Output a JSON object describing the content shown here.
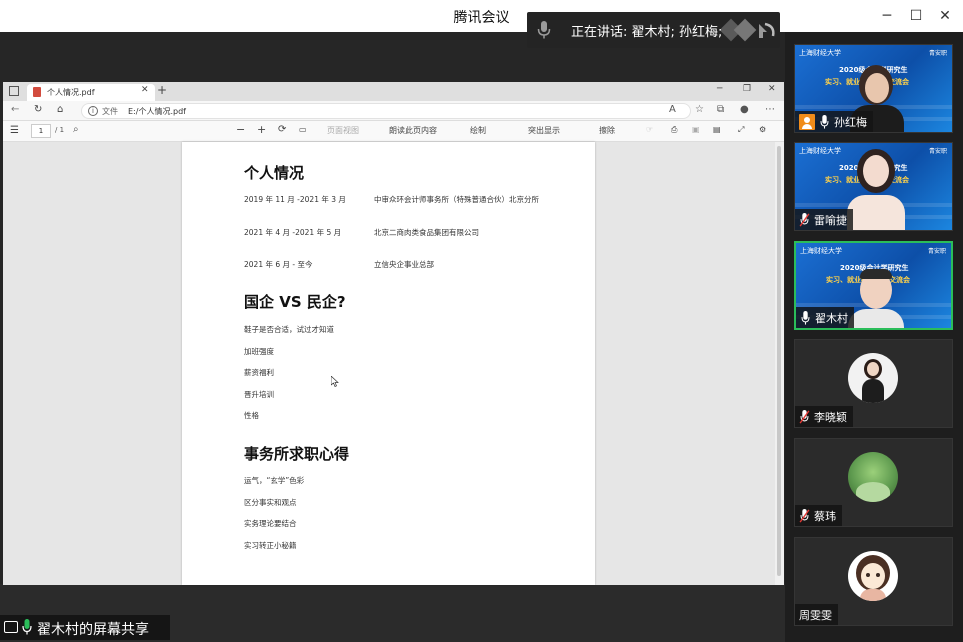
{
  "window": {
    "app_title": "腾讯会议",
    "speaking_label": "正在讲话: 翟木村; 孙红梅;"
  },
  "browser": {
    "tab_title": "个人情况.pdf",
    "url_label": "文件",
    "url": "E:/个人情况.pdf",
    "page_number": "1",
    "page_total": "/ 1",
    "toolbar": {
      "page_view": "页面视图",
      "read_aloud": "朗读此页内容",
      "draw": "绘制",
      "highlight": "突出显示",
      "erase": "擦除"
    }
  },
  "document": {
    "section1_title": "个人情况",
    "experience": [
      {
        "period": "2019 年 11 月 -2021 年 3 月",
        "org": "中审众环会计师事务所（特殊普通合伙）北京分所"
      },
      {
        "period": "2021 年 4 月 -2021 年 5 月",
        "org": "北京二商肉类食品集团有限公司"
      },
      {
        "period": "2021 年 6 月 - 至今",
        "org": "立信央企事业总部"
      }
    ],
    "section2_title": "国企 VS 民企?",
    "section2_items": [
      "鞋子是否合适，试过才知道",
      "加班强度",
      "薪资福利",
      "晋升培训",
      "性格"
    ],
    "section3_title": "事务所求职心得",
    "section3_items": [
      "运气，“玄学”色彩",
      "区分事实和观点",
      "实务理论要结合",
      "实习转正小秘籍"
    ]
  },
  "share": {
    "label": "翟木村的屏幕共享"
  },
  "banner": {
    "logo_left": "上海财经大学",
    "logo_right": "青安职",
    "line1": "2020级会计学研究生",
    "line2": "实习、就业经验分享交流会"
  },
  "participants": [
    {
      "name": "孙红梅",
      "kind": "video-banner",
      "avatar_color": "#f08c1a"
    },
    {
      "name": "雷喻捷",
      "kind": "video-banner",
      "avatar_color": "#f5e5dc"
    },
    {
      "name": "翟木村",
      "kind": "video-banner-active",
      "avatar_color": "#e9e9e9"
    },
    {
      "name": "李晓颖",
      "kind": "avatar",
      "avatar_color": "#f2f2f2"
    },
    {
      "name": "蔡玮",
      "kind": "avatar",
      "avatar_color": "#5e9a4f"
    },
    {
      "name": "周雯雯",
      "kind": "avatar",
      "avatar_color": "#fbe9d6"
    }
  ],
  "colors": {
    "active_speaker_border": "#2bbd5a",
    "banner_blue": "#1b6fd3",
    "pdf_icon": "#d24b3e"
  }
}
